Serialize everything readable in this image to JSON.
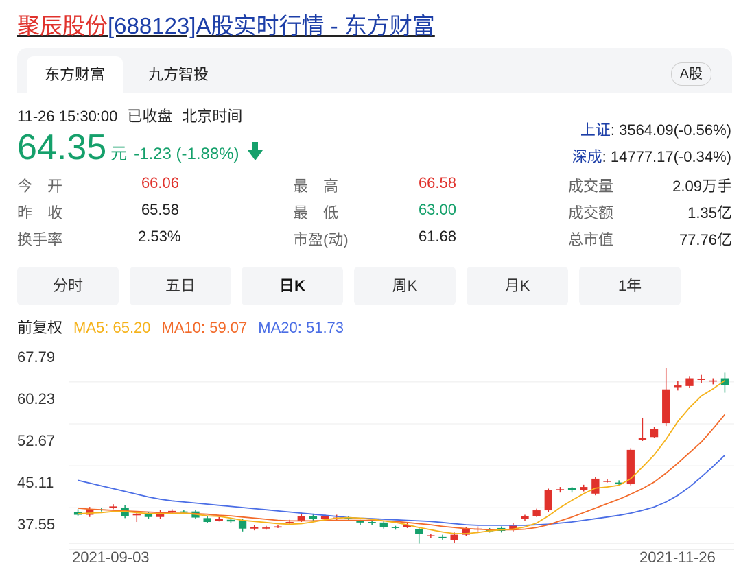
{
  "page": {
    "title_name": "聚辰股份",
    "title_rest": "[688123]A股实时行情 - 东方财富"
  },
  "tabs": [
    {
      "label": "东方财富"
    },
    {
      "label": "九方智投"
    }
  ],
  "badge": "A股",
  "status": {
    "time": "11-26 15:30:00",
    "state": "已收盘",
    "zone": "北京时间"
  },
  "price": {
    "value": "64.35",
    "unit": "元",
    "change": "-1.23 (-1.88%)"
  },
  "indices": [
    {
      "label": "上证",
      "value": ": 3564.09(-0.56%)"
    },
    {
      "label": "深成",
      "value": ": 14777.17(-0.34%)"
    }
  ],
  "stats": [
    [
      {
        "label": "今　开",
        "value": "66.06",
        "tone": "red"
      },
      {
        "label": "最　高",
        "value": "66.58",
        "tone": "red"
      },
      {
        "label": "成交量",
        "value": "2.09万手",
        "tone": "dark"
      }
    ],
    [
      {
        "label": "昨　收",
        "value": "65.58",
        "tone": "dark"
      },
      {
        "label": "最　低",
        "value": "63.00",
        "tone": "green"
      },
      {
        "label": "成交额",
        "value": "1.35亿",
        "tone": "dark"
      }
    ],
    [
      {
        "label": "换手率",
        "value": "2.53%",
        "tone": "dark"
      },
      {
        "label": "市盈(动)",
        "value": "61.68",
        "tone": "dark"
      },
      {
        "label": "总市值",
        "value": "77.76亿",
        "tone": "dark"
      }
    ]
  ],
  "periods": [
    "分时",
    "五日",
    "日K",
    "周K",
    "月K",
    "1年"
  ],
  "active_period": "日K",
  "ma_legend": {
    "adjust": "前复权",
    "ma5": "MA5: 65.20",
    "ma10": "MA10: 59.07",
    "ma20": "MA20: 51.73"
  },
  "colors": {
    "up": "#e0322c",
    "down": "#15a06b",
    "ma5": "#f5b21a",
    "ma10": "#f26a2a",
    "ma20": "#4a6de5",
    "link": "#1d3fa8"
  },
  "chart_data": {
    "type": "candlestick",
    "title": "",
    "ylim": [
      35.5,
      69.5
    ],
    "y_ticks": [
      "67.79",
      "60.23",
      "52.67",
      "45.11",
      "37.55"
    ],
    "y_tick_values": [
      67.79,
      60.23,
      52.67,
      45.11,
      37.55
    ],
    "x_labels": [
      "2021-09-03",
      "2021-11-26"
    ],
    "candles": [
      [
        41.5,
        41.0,
        42.0,
        40.8
      ],
      [
        41.0,
        42.0,
        42.4,
        40.6
      ],
      [
        42.0,
        41.9,
        42.3,
        41.6
      ],
      [
        42.3,
        42.5,
        42.9,
        42.0
      ],
      [
        42.3,
        40.7,
        42.7,
        40.4
      ],
      [
        40.9,
        41.2,
        41.6,
        39.7
      ],
      [
        41.1,
        40.6,
        41.5,
        40.3
      ],
      [
        40.6,
        41.5,
        41.9,
        40.3
      ],
      [
        41.5,
        41.7,
        42.0,
        41.3
      ],
      [
        41.6,
        41.4,
        41.8,
        41.2
      ],
      [
        41.6,
        40.5,
        41.9,
        40.3
      ],
      [
        40.4,
        39.7,
        40.8,
        39.5
      ],
      [
        39.9,
        40.2,
        40.6,
        39.8
      ],
      [
        40.1,
        39.8,
        40.4,
        39.5
      ],
      [
        40.0,
        38.5,
        40.2,
        38.0
      ],
      [
        38.5,
        38.8,
        39.1,
        38.2
      ],
      [
        38.5,
        38.7,
        39.0,
        38.3
      ],
      [
        38.7,
        38.9,
        39.1,
        38.6
      ],
      [
        39.7,
        39.7,
        40.1,
        39.4
      ],
      [
        40.0,
        40.8,
        41.4,
        39.7
      ],
      [
        40.8,
        40.3,
        41.2,
        39.9
      ],
      [
        40.3,
        40.7,
        41.1,
        40.0
      ],
      [
        40.5,
        40.5,
        41.0,
        40.1
      ],
      [
        40.5,
        40.4,
        40.8,
        40.1
      ],
      [
        39.9,
        39.6,
        40.1,
        39.2
      ],
      [
        39.7,
        39.6,
        40.0,
        39.2
      ],
      [
        39.6,
        38.8,
        40.0,
        38.5
      ],
      [
        38.8,
        38.6,
        39.0,
        38.3
      ],
      [
        38.8,
        39.2,
        39.5,
        38.6
      ],
      [
        38.4,
        37.5,
        38.6,
        35.8
      ],
      [
        37.2,
        37.3,
        37.6,
        36.8
      ],
      [
        37.0,
        36.8,
        37.4,
        36.5
      ],
      [
        36.4,
        37.4,
        37.8,
        36.0
      ],
      [
        37.4,
        38.4,
        38.8,
        37.2
      ],
      [
        38.4,
        38.5,
        38.9,
        37.9
      ],
      [
        38.3,
        38.0,
        38.6,
        37.8
      ],
      [
        38.6,
        38.1,
        38.9,
        37.8
      ],
      [
        38.3,
        39.2,
        39.5,
        38.0
      ],
      [
        40.2,
        40.8,
        41.0,
        39.9
      ],
      [
        40.8,
        41.8,
        42.1,
        40.6
      ],
      [
        41.8,
        45.5,
        45.7,
        41.5
      ],
      [
        45.5,
        45.6,
        46.0,
        45.0
      ],
      [
        45.8,
        45.4,
        46.0,
        45.0
      ],
      [
        45.5,
        46.0,
        46.4,
        45.2
      ],
      [
        44.8,
        47.5,
        47.8,
        44.5
      ],
      [
        47.0,
        47.1,
        47.4,
        46.8
      ],
      [
        46.8,
        46.5,
        47.2,
        46.3
      ],
      [
        46.5,
        52.7,
        53.0,
        46.3
      ],
      [
        54.5,
        54.8,
        58.5,
        54.3
      ],
      [
        55.0,
        56.5,
        56.8,
        54.8
      ],
      [
        57.5,
        63.6,
        67.4,
        57.0
      ],
      [
        64.0,
        64.3,
        65.1,
        63.4
      ],
      [
        64.2,
        65.6,
        66.0,
        63.9
      ],
      [
        65.3,
        65.5,
        66.2,
        64.7
      ],
      [
        65.0,
        65.2,
        65.6,
        64.5
      ],
      [
        65.6,
        64.4,
        66.6,
        63.0
      ]
    ],
    "ma5": [
      41.2,
      41.3,
      41.4,
      41.6,
      41.6,
      41.4,
      41.2,
      41.2,
      41.2,
      41.3,
      41.1,
      40.8,
      40.7,
      40.4,
      40.0,
      39.8,
      39.6,
      39.4,
      39.3,
      39.4,
      39.7,
      40.1,
      40.4,
      40.5,
      40.4,
      40.2,
      39.9,
      39.6,
      39.2,
      38.7,
      38.3,
      37.9,
      37.6,
      37.6,
      37.8,
      38.1,
      38.3,
      38.4,
      38.8,
      39.5,
      40.8,
      42.3,
      43.6,
      44.8,
      45.8,
      46.0,
      46.3,
      47.5,
      49.6,
      51.8,
      54.6,
      57.8,
      60.3,
      62.4,
      63.7,
      65.2
    ],
    "ma10": [
      42.2,
      42.0,
      41.9,
      41.8,
      41.7,
      41.6,
      41.5,
      41.4,
      41.3,
      41.3,
      41.2,
      41.1,
      40.9,
      40.8,
      40.6,
      40.4,
      40.2,
      40.0,
      39.9,
      39.9,
      39.9,
      40.0,
      40.0,
      40.0,
      40.0,
      40.0,
      39.9,
      39.8,
      39.6,
      39.4,
      39.2,
      38.9,
      38.7,
      38.5,
      38.4,
      38.3,
      38.3,
      38.3,
      38.4,
      38.7,
      39.2,
      39.9,
      40.6,
      41.4,
      42.2,
      43.0,
      43.8,
      44.7,
      45.7,
      46.9,
      48.5,
      50.3,
      52.2,
      54.1,
      56.5,
      59.07
    ],
    "ma20": [
      47.2,
      46.7,
      46.2,
      45.7,
      45.2,
      44.7,
      44.2,
      43.8,
      43.5,
      43.3,
      43.1,
      42.9,
      42.7,
      42.5,
      42.3,
      42.1,
      41.9,
      41.7,
      41.5,
      41.3,
      41.1,
      40.9,
      40.7,
      40.5,
      40.4,
      40.3,
      40.2,
      40.1,
      40.0,
      39.9,
      39.8,
      39.6,
      39.4,
      39.2,
      39.1,
      39.1,
      39.1,
      39.1,
      39.1,
      39.2,
      39.3,
      39.5,
      39.7,
      40.0,
      40.3,
      40.6,
      40.9,
      41.3,
      41.8,
      42.4,
      43.3,
      44.5,
      46.0,
      47.8,
      49.7,
      51.73
    ]
  }
}
